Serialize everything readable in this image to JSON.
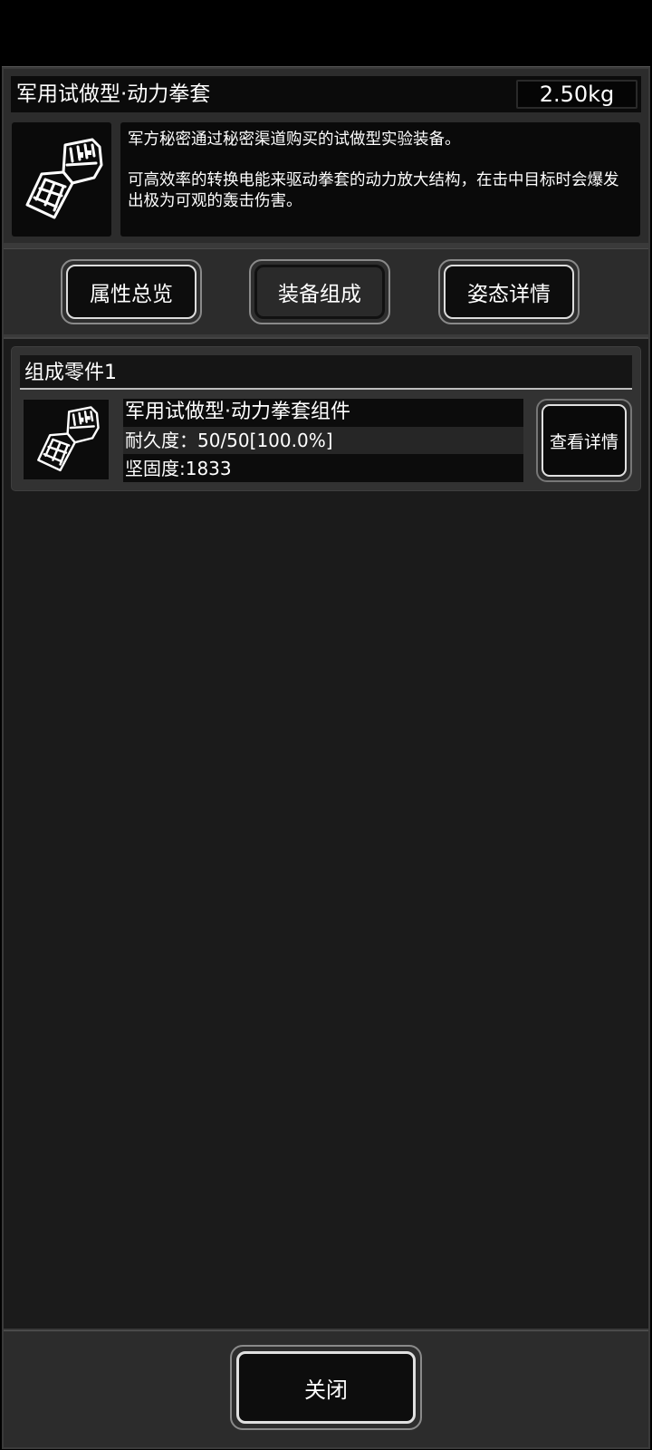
{
  "item": {
    "title": "军用试做型·动力拳套",
    "weight": "2.50kg",
    "icon": "power-gauntlet-icon",
    "description_1": "军方秘密通过秘密渠道购买的试做型实验装备。",
    "description_2": "可高效率的转换电能来驱动拳套的动力放大结构，在击中目标时会爆发出极为可观的轰击伤害。"
  },
  "tabs": [
    {
      "label": "属性总览",
      "active": false
    },
    {
      "label": "装备组成",
      "active": true
    },
    {
      "label": "姿态详情",
      "active": false
    }
  ],
  "parts": {
    "header": "组成零件1",
    "name": "军用试做型·动力拳套组件",
    "durability": "耐久度：50/50[100.0%]",
    "hardness": "坚固度:1833",
    "detail_label": "查看详情",
    "icon": "power-gauntlet-icon"
  },
  "footer": {
    "close_label": "关闭"
  },
  "colors": {
    "background": "#1b1b1b",
    "panel": "#2c2c2c",
    "box": "#0a0a0a",
    "text": "#ffffff"
  }
}
